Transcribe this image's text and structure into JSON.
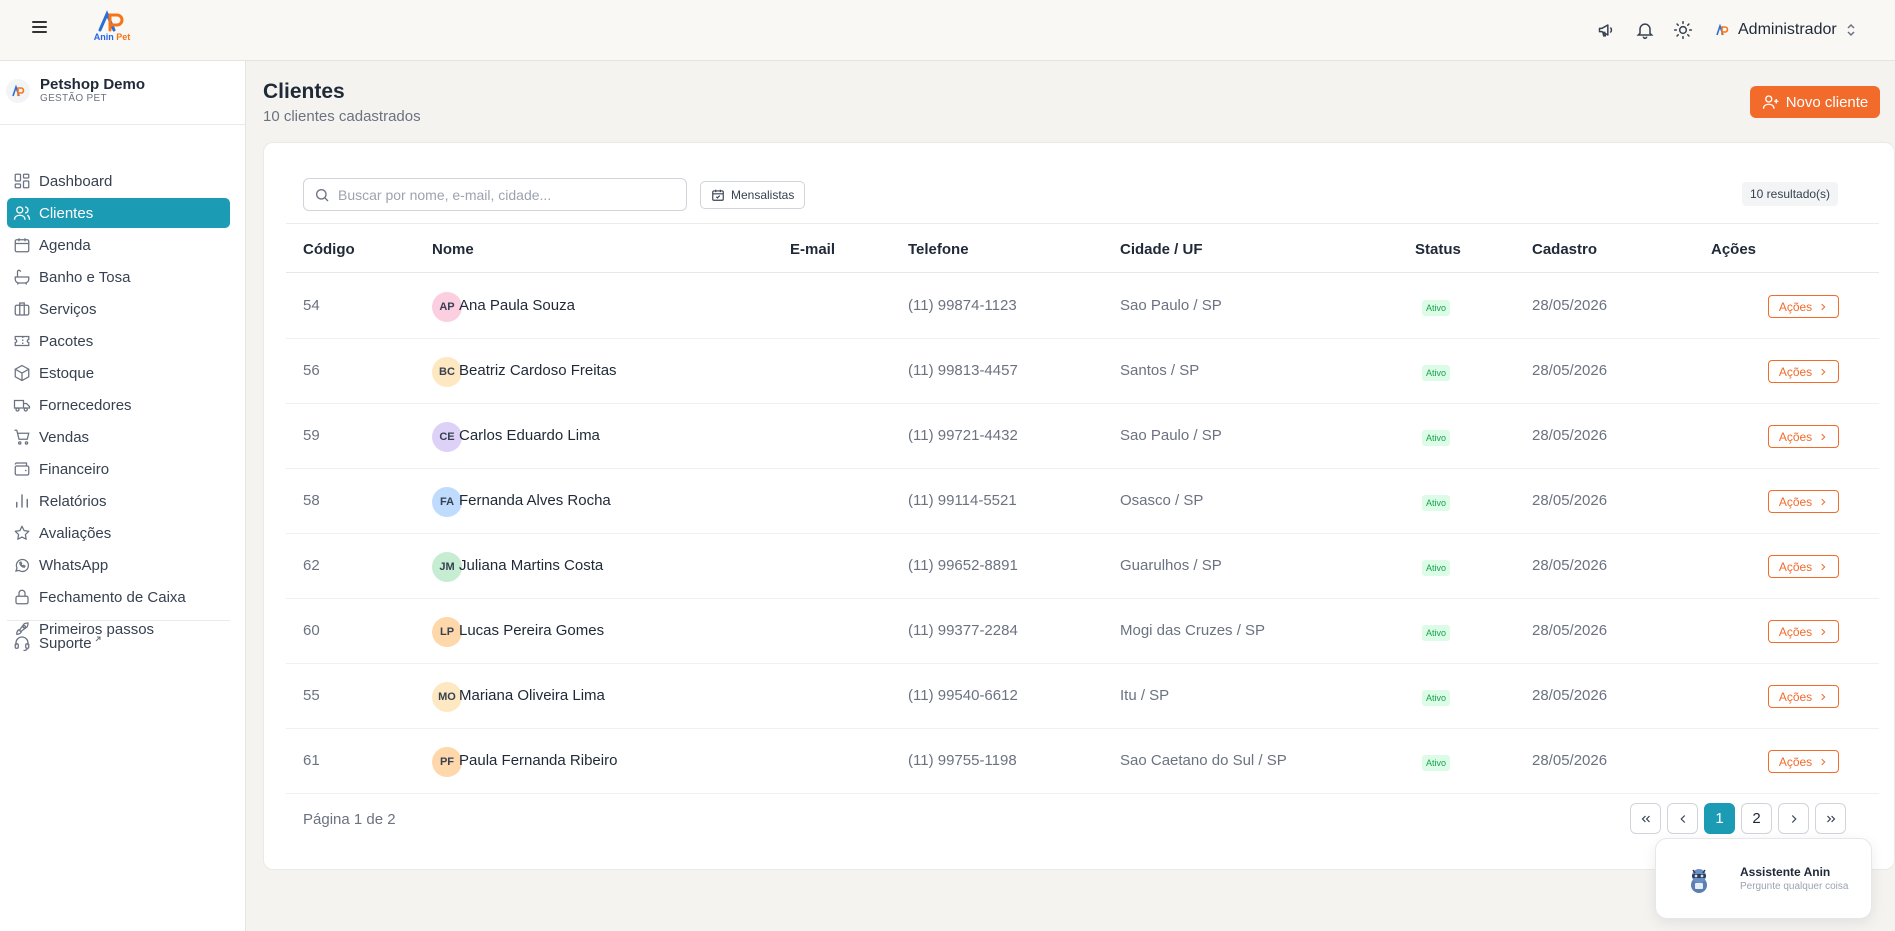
{
  "brand": {
    "logo_text_a": "Anin",
    "logo_text_b": "Pet",
    "accent": "#1b9bb4",
    "orange": "#f26b2a"
  },
  "header": {
    "user_name": "Administrador",
    "icons": [
      "megaphone-icon",
      "bell-icon",
      "sun-icon"
    ]
  },
  "org": {
    "name": "Petshop Demo",
    "subtitle": "GESTÃO PET"
  },
  "sidebar": {
    "items": [
      {
        "label": "Dashboard",
        "icon": "dashboard-icon"
      },
      {
        "label": "Clientes",
        "icon": "users-icon",
        "active": true
      },
      {
        "label": "Agenda",
        "icon": "calendar-icon"
      },
      {
        "label": "Banho e Tosa",
        "icon": "bath-icon"
      },
      {
        "label": "Serviços",
        "icon": "briefcase-icon"
      },
      {
        "label": "Pacotes",
        "icon": "ticket-icon"
      },
      {
        "label": "Estoque",
        "icon": "box-icon"
      },
      {
        "label": "Fornecedores",
        "icon": "truck-icon"
      },
      {
        "label": "Vendas",
        "icon": "cart-icon"
      },
      {
        "label": "Financeiro",
        "icon": "wallet-icon"
      },
      {
        "label": "Relatórios",
        "icon": "bar-chart-icon"
      },
      {
        "label": "Avaliações",
        "icon": "star-icon"
      },
      {
        "label": "WhatsApp",
        "icon": "whatsapp-icon"
      },
      {
        "label": "Fechamento de Caixa",
        "icon": "lock-icon"
      },
      {
        "label": "Primeiros passos",
        "icon": "rocket-icon"
      }
    ],
    "support_label": "Suporte"
  },
  "main": {
    "title": "Clientes",
    "subtitle": "10 clientes cadastrados",
    "new_button": "Novo cliente",
    "search_placeholder": "Buscar por nome, e-mail, cidade...",
    "filter_button": "Mensalistas",
    "result_count": "10 resultado(s)",
    "columns": [
      "Código",
      "Nome",
      "E-mail",
      "Telefone",
      "Cidade / UF",
      "Status",
      "Cadastro",
      "Ações"
    ],
    "rows": [
      {
        "codigo": "54",
        "initials": "AP",
        "avatar_color": "#fbcfe0",
        "nome": "Ana Paula Souza",
        "email": "",
        "telefone": "(11) 99874-1123",
        "cidade": "Sao Paulo / SP",
        "status": "Ativo",
        "cadastro": "28/05/2026",
        "acoes": "Ações"
      },
      {
        "codigo": "56",
        "initials": "BC",
        "avatar_color": "#fde8c2",
        "nome": "Beatriz Cardoso Freitas",
        "email": "",
        "telefone": "(11) 99813-4457",
        "cidade": "Santos / SP",
        "status": "Ativo",
        "cadastro": "28/05/2026",
        "acoes": "Ações"
      },
      {
        "codigo": "59",
        "initials": "CE",
        "avatar_color": "#ddd1f7",
        "nome": "Carlos Eduardo Lima",
        "email": "",
        "telefone": "(11) 99721-4432",
        "cidade": "Sao Paulo / SP",
        "status": "Ativo",
        "cadastro": "28/05/2026",
        "acoes": "Ações"
      },
      {
        "codigo": "58",
        "initials": "FA",
        "avatar_color": "#bfdbfe",
        "nome": "Fernanda Alves Rocha",
        "email": "",
        "telefone": "(11) 99114-5521",
        "cidade": "Osasco / SP",
        "status": "Ativo",
        "cadastro": "28/05/2026",
        "acoes": "Ações"
      },
      {
        "codigo": "62",
        "initials": "JM",
        "avatar_color": "#c6ecd2",
        "nome": "Juliana Martins Costa",
        "email": "",
        "telefone": "(11) 99652-8891",
        "cidade": "Guarulhos / SP",
        "status": "Ativo",
        "cadastro": "28/05/2026",
        "acoes": "Ações"
      },
      {
        "codigo": "60",
        "initials": "LP",
        "avatar_color": "#fed7aa",
        "nome": "Lucas Pereira Gomes",
        "email": "",
        "telefone": "(11) 99377-2284",
        "cidade": "Mogi das Cruzes / SP",
        "status": "Ativo",
        "cadastro": "28/05/2026",
        "acoes": "Ações"
      },
      {
        "codigo": "55",
        "initials": "MO",
        "avatar_color": "#fde8c2",
        "nome": "Mariana Oliveira Lima",
        "email": "",
        "telefone": "(11) 99540-6612",
        "cidade": "Itu / SP",
        "status": "Ativo",
        "cadastro": "28/05/2026",
        "acoes": "Ações"
      },
      {
        "codigo": "61",
        "initials": "PF",
        "avatar_color": "#fed7aa",
        "nome": "Paula Fernanda Ribeiro",
        "email": "",
        "telefone": "(11) 99755-1198",
        "cidade": "Sao Caetano do Sul / SP",
        "status": "Ativo",
        "cadastro": "28/05/2026",
        "acoes": "Ações"
      }
    ],
    "page_info": "Página 1 de 2",
    "pager": {
      "pages": [
        "1",
        "2"
      ],
      "current": "1"
    }
  },
  "assistant": {
    "title": "Assistente Anin",
    "subtitle": "Pergunte qualquer coisa"
  }
}
